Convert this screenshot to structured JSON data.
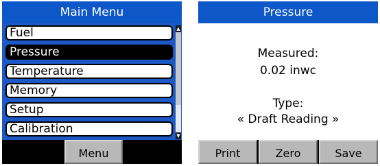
{
  "main_menu": {
    "title": "Main Menu",
    "items": [
      {
        "label": "Fuel"
      },
      {
        "label": "Pressure"
      },
      {
        "label": "Temperature"
      },
      {
        "label": "Memory"
      },
      {
        "label": "Setup"
      },
      {
        "label": "Calibration"
      }
    ],
    "selected_item": "Pressure",
    "softkeys": {
      "center": "Menu"
    }
  },
  "pressure": {
    "title": "Pressure",
    "measured_label": "Measured:",
    "measured_value": "0.02 inwc",
    "type_label": "Type:",
    "type_value": "« Draft Reading »",
    "softkeys": {
      "left": "Print",
      "center": "Zero",
      "right": "Save"
    }
  },
  "colors": {
    "title_bar": "#0d57c9",
    "menu_background": "#1c58c6",
    "softkey": "#b8b8b8",
    "selected": "#000000"
  }
}
